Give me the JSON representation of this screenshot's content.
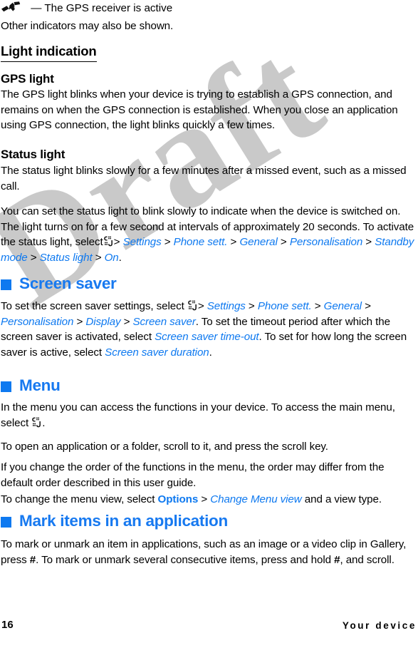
{
  "document": {
    "type": "user-guide-page",
    "watermark": "Draft",
    "accent_color": "#0e79f0",
    "text_color": "#000000",
    "watermark_color": "#c9c9c9",
    "background_color": "#ffffff"
  },
  "top": {
    "gps_icon_name": "satellite-icon",
    "gps_indicator_line": "— The GPS receiver is active",
    "other_indicators": "Other indicators may also be shown."
  },
  "light_indication": {
    "heading": "Light indication",
    "gps_light": {
      "heading": "GPS light",
      "paragraph": "The GPS light blinks when your device is trying to establish a GPS connection, and remains on when the GPS connection is established. When you close an application using GPS connection, the light blinks quickly a few times."
    },
    "status_light": {
      "heading": "Status light",
      "paragraph_1": "The status light blinks slowly for a few minutes after a missed event, such as a missed call.",
      "paragraph_2_part_1": "You can set the status light to blink slowly to indicate when the device is switched on. The light turns on for a few second at intervals of approximately 20 seconds. To activate the status light, select",
      "menu_icon_name": "menu-grid-icon",
      "path": [
        "Settings",
        "Phone sett.",
        "General",
        "Personalisation",
        "Standby mode",
        "Status light",
        "On"
      ],
      "path_separator": ">",
      "trailing_period": "."
    }
  },
  "screen_saver": {
    "heading": "Screen saver",
    "bullet_name": "blue-square-bullet",
    "para_lead": "To set the screen saver settings, select",
    "menu_icon_name": "menu-grid-icon",
    "path": [
      "Settings",
      "Phone sett.",
      "General",
      "Personalisation",
      "Display",
      "Screen saver"
    ],
    "path_separator": ">",
    "after_path_1": ". To set the timeout period after which the screen saver is activated, select",
    "link_timeout": "Screen saver time-out",
    "after_path_2": ". To set for how long the screen saver is active, select",
    "link_duration": "Screen saver duration",
    "end_period": "."
  },
  "menu": {
    "heading": "Menu",
    "bullet_name": "blue-square-bullet",
    "para_1_lead": "In the menu you can access the functions in your device. To access the main menu, select",
    "menu_icon_name": "menu-grid-icon",
    "para_1_end": ".",
    "para_2": "To open an application or a folder, scroll to it, and press the scroll key.",
    "para_3": "If you change the order of the functions in the menu, the order may differ from the default order described in this user guide.",
    "para_4_lead": "To change the menu view, select",
    "para_4_options": "Options",
    "para_4_sep": ">",
    "para_4_link": "Change Menu view",
    "para_4_end": "and a view type."
  },
  "mark_items": {
    "heading": "Mark items in an application",
    "bullet_name": "blue-square-bullet",
    "para_part_1": "To mark or unmark an item in applications, such as an image or a video clip in Gallery, press",
    "key_hash_1": "#",
    "para_part_2": ". To mark or unmark several consecutive items, press and hold",
    "key_hash_2": "#",
    "para_part_3": ", and scroll."
  },
  "footer": {
    "page_number": "16",
    "section_title": "Your device"
  }
}
